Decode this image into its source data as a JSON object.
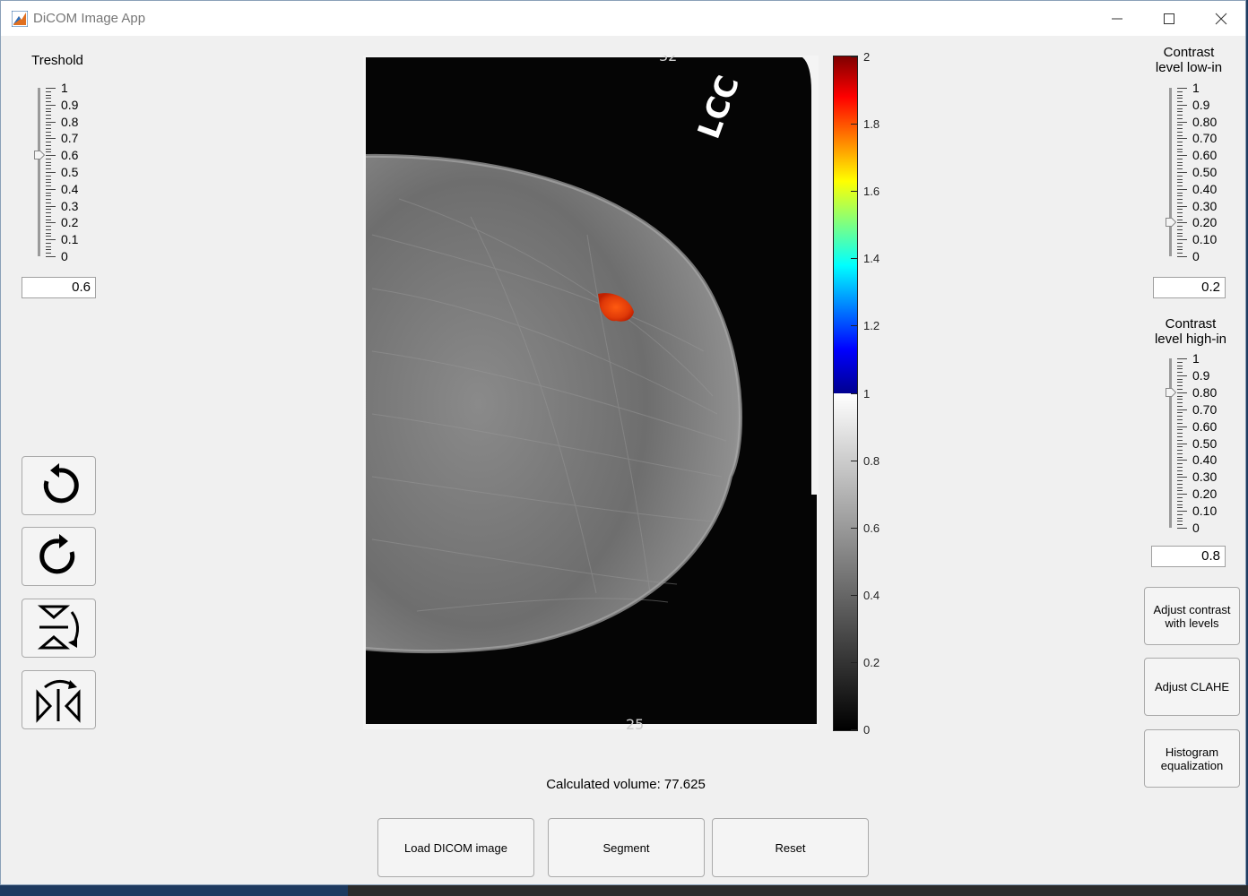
{
  "window": {
    "title": "DiCOM Image App",
    "controls": [
      "minimize",
      "maximize",
      "close"
    ]
  },
  "threshold": {
    "label": "Treshold",
    "ticks": [
      "1",
      "0.9",
      "0.8",
      "0.7",
      "0.6",
      "0.5",
      "0.4",
      "0.3",
      "0.2",
      "0.1",
      "0"
    ],
    "value": "0.6"
  },
  "contrast_low": {
    "label_line1": "Contrast",
    "label_line2": "level low-in",
    "ticks": [
      "1",
      "0.9",
      "0.80",
      "0.70",
      "0.60",
      "0.50",
      "0.40",
      "0.30",
      "0.20",
      "0.10",
      "0"
    ],
    "value": "0.2"
  },
  "contrast_high": {
    "label_line1": "Contrast",
    "label_line2": "level high-in",
    "ticks": [
      "1",
      "0.9",
      "0.80",
      "0.70",
      "0.60",
      "0.50",
      "0.40",
      "0.30",
      "0.20",
      "0.10",
      "0"
    ],
    "value": "0.8"
  },
  "tool_icons": [
    "rotate-left-icon",
    "rotate-right-icon",
    "flip-vertical-icon",
    "flip-horizontal-icon"
  ],
  "right_buttons": {
    "adjust_levels_line1": "Adjust contrast",
    "adjust_levels_line2": "with levels",
    "adjust_clahe": "Adjust CLAHE",
    "histogram_line1": "Histogram",
    "histogram_line2": "equalization"
  },
  "image": {
    "marker_text": "LCC"
  },
  "colorbar": {
    "labels": [
      "2",
      "1.8",
      "1.6",
      "1.4",
      "1.2",
      "1",
      "0.8",
      "0.6",
      "0.4",
      "0.2",
      "0"
    ]
  },
  "status": {
    "volume_text": "Calculated volume: 77.625"
  },
  "bottom_buttons": {
    "load": "Load DICOM image",
    "segment": "Segment",
    "reset": "Reset"
  }
}
